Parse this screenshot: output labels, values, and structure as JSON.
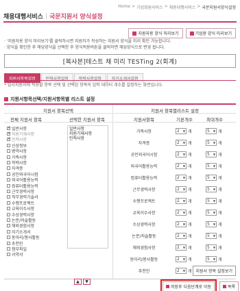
{
  "breadcrumb": [
    "Home",
    ">",
    "기업회원서비스",
    ">",
    "채용대행서비스",
    ">",
    "국문지원서양식설정"
  ],
  "header": {
    "title": "채용대행서비스",
    "subtitle": "국문지원서 양식설정"
  },
  "top_buttons": {
    "preview": "지원자용 양식 미리보기",
    "corp_preview": "기업용 양식 미리보기"
  },
  "notes": [
    "· '지원자용 양식 미리보기'를 클릭하시면 지원자가 작성하는 지원서 양식을 미리 확인 가능합니다.",
    "· 양식을 확인한 후 해당양식을 선택한 후 양식적용버튼을 클릭하면 해당양식으로 변경 됩니다."
  ],
  "template_name": "[복사본]테스트 채 미리 TESTing 2(회계)",
  "tabs": [
    "지원서항목설정",
    "인적사항설정",
    "학력사항설정",
    "자기소개서설정"
  ],
  "tab_note": "* 입사지원서에 적용할 항목 선택 및 선택된 항목의 입력 데이터 개수를 설정하는 화면입니다.",
  "section_title": "지원서항목선택/지원서항목별 리스트 설정",
  "left_headers": {
    "group": "지원서 항목선택",
    "all": "전체 지원서 항목",
    "selected": "선택한 지원서 항목"
  },
  "all_items": [
    {
      "label": "일반사항",
      "checked": true,
      "dim": false
    },
    {
      "label": "지원기재사항",
      "checked": true,
      "dim": true
    },
    {
      "label": "인적사항",
      "checked": true,
      "dim": true
    },
    {
      "label": "신상정보",
      "checked": false,
      "dim": false
    },
    {
      "label": "병역사항",
      "checked": false,
      "dim": false
    },
    {
      "label": "가족사항",
      "checked": false,
      "dim": false
    },
    {
      "label": "학력사항",
      "checked": false,
      "dim": false
    },
    {
      "label": "자격증",
      "checked": false,
      "dim": false
    },
    {
      "label": "공인외국어시험",
      "checked": false,
      "dim": false
    },
    {
      "label": "외국어활용능력",
      "checked": false,
      "dim": false
    },
    {
      "label": "컴퓨터활용능력",
      "checked": false,
      "dim": false
    },
    {
      "label": "근무경력사항",
      "checked": false,
      "dim": false
    },
    {
      "label": "직무경력기술서",
      "checked": false,
      "dim": false
    },
    {
      "label": "수행프로젝트",
      "checked": false,
      "dim": false
    },
    {
      "label": "교육이수사항",
      "checked": false,
      "dim": false
    },
    {
      "label": "수상경력사항",
      "checked": false,
      "dim": false
    },
    {
      "label": "논문/저술활동",
      "checked": false,
      "dim": false
    },
    {
      "label": "해외경험사항",
      "checked": false,
      "dim": false
    },
    {
      "label": "자기소개서",
      "checked": false,
      "dim": false
    },
    {
      "label": "동아리/봉사활동",
      "checked": false,
      "dim": false
    },
    {
      "label": "추천인",
      "checked": false,
      "dim": false
    },
    {
      "label": "첨부파일",
      "checked": false,
      "dim": false
    },
    {
      "label": "서약서",
      "checked": false,
      "dim": false
    }
  ],
  "selected_items": [
    "일반사항",
    "지원기재사항",
    "인적사항"
  ],
  "right_headers": {
    "group": "지원서 항목별리스트 설정",
    "item": "지원서항목",
    "basic": "기본개수",
    "max": "최대개수"
  },
  "right_rows": [
    {
      "name": "가족사항",
      "basic": "2",
      "max": "5"
    },
    {
      "name": "자격증",
      "basic": "2",
      "max": "5"
    },
    {
      "name": "공인외국어시험",
      "basic": "2",
      "max": "5"
    },
    {
      "name": "외국어활용능력",
      "basic": "2",
      "max": "5"
    },
    {
      "name": "컴퓨터활용능력",
      "basic": "2",
      "max": "5"
    },
    {
      "name": "근무경력사항",
      "basic": "2",
      "max": "5"
    },
    {
      "name": "수행프로젝트",
      "basic": "2",
      "max": "5"
    },
    {
      "name": "교육이수사항",
      "basic": "2",
      "max": "5"
    },
    {
      "name": "수상경력사항",
      "basic": "2",
      "max": "5"
    },
    {
      "name": "논문/저술활동",
      "basic": "2",
      "max": "5"
    },
    {
      "name": "해외경험사항",
      "basic": "2",
      "max": "5"
    },
    {
      "name": "동아리/봉사활동",
      "basic": "2",
      "max": "5"
    },
    {
      "name": "추천인",
      "basic": "2",
      "max": "5"
    }
  ],
  "unit": "개",
  "apply_list_button": "지원서 항목 설정보기",
  "next_button": "저장후 다음단계로 이동",
  "list_button": "목록",
  "colors": {
    "accent": "#c83c64",
    "highlight": "#d42020"
  }
}
